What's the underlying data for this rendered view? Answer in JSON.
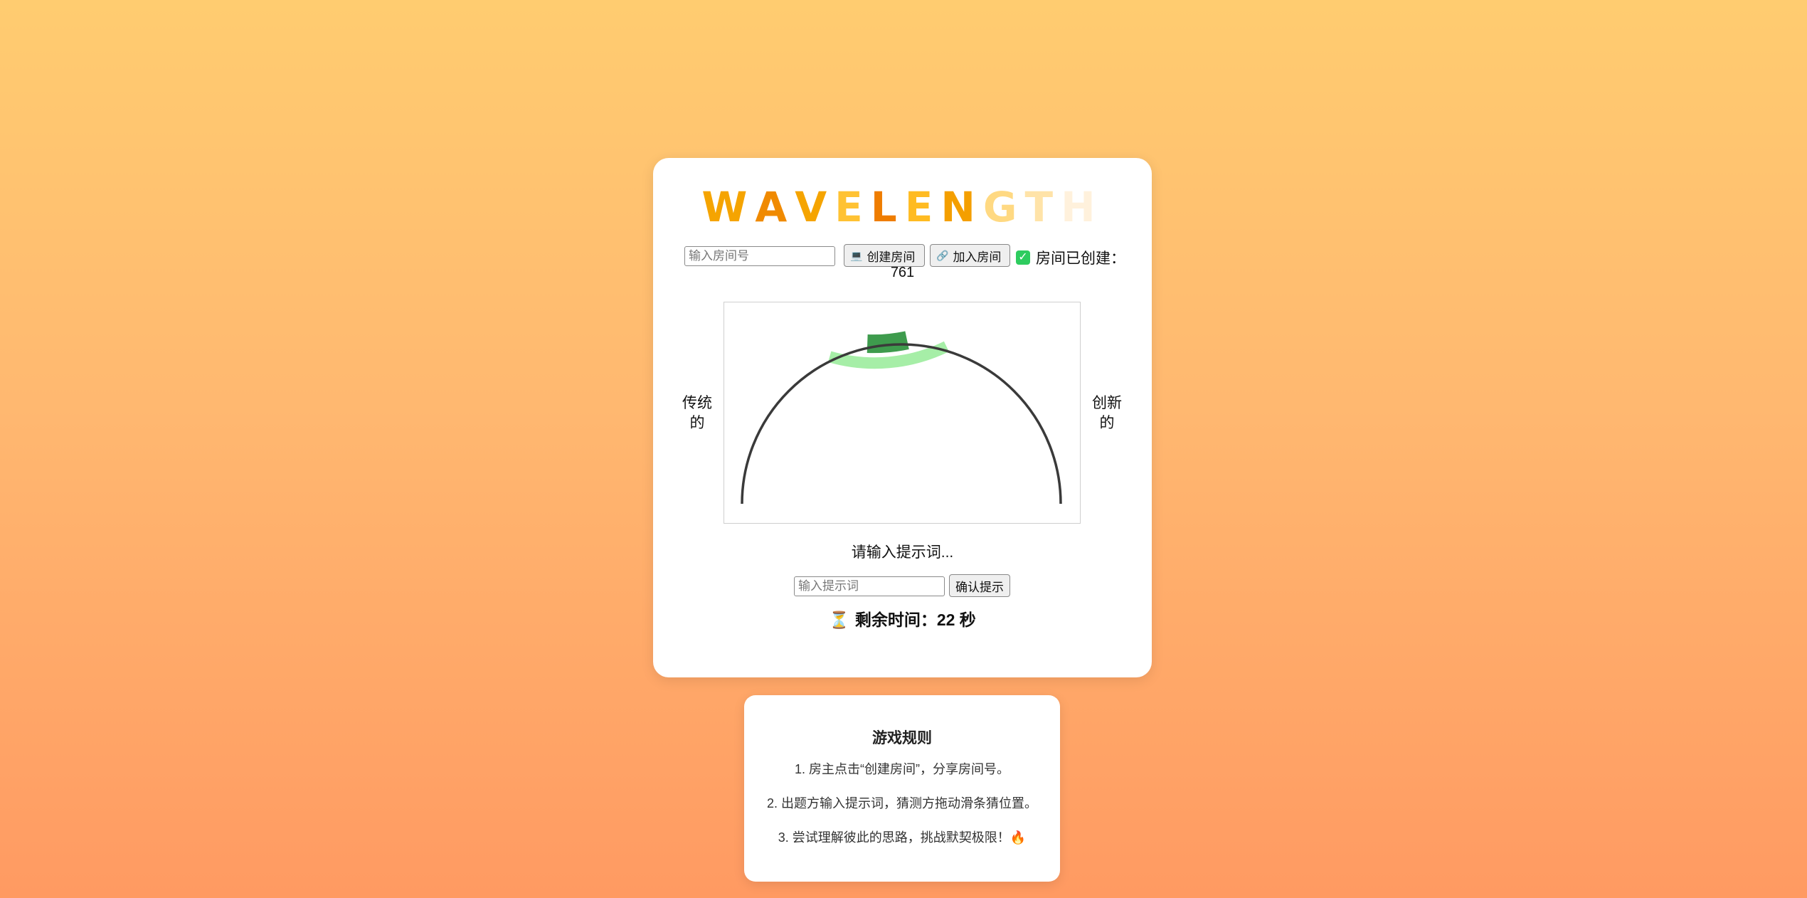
{
  "title": {
    "letters": [
      {
        "char": "W",
        "color": "#f5a400"
      },
      {
        "char": "A",
        "color": "#f08a00"
      },
      {
        "char": "V",
        "color": "#f5a400"
      },
      {
        "char": "E",
        "color": "#ffc233"
      },
      {
        "char": "L",
        "color": "#ef7d00"
      },
      {
        "char": "E",
        "color": "#ffbb22"
      },
      {
        "char": "N",
        "color": "#f49f00"
      },
      {
        "char": "G",
        "color": "#ffd982"
      },
      {
        "char": "T",
        "color": "#ffe3a8"
      },
      {
        "char": "H",
        "color": "#fff1dc"
      }
    ]
  },
  "room": {
    "input_placeholder": "输入房间号",
    "create_icon": "💻",
    "create_label": "创建房间",
    "join_icon": "🔗",
    "join_label": "加入房间",
    "status_icon": "✓",
    "status_text": "房间已创建：",
    "room_number": "761"
  },
  "dial": {
    "left_label": "传统的",
    "right_label": "创新的",
    "target_angle_deg": 85,
    "inner_band_half_width_deg": 7,
    "outer_band_half_width_deg": 21,
    "colors": {
      "arc": "#3a3a3a",
      "inner_band": "#3e9b4d",
      "outer_band": "#a6eea7"
    }
  },
  "prompt": {
    "status_text": "请输入提示词...",
    "input_placeholder": "输入提示词",
    "confirm_label": "确认提示"
  },
  "timer": {
    "icon": "⏳",
    "text": "剩余时间：22 秒"
  },
  "rules": {
    "title": "游戏规则",
    "items": [
      "1. 房主点击“创建房间”，分享房间号。",
      "2. 出题方输入提示词，猜测方拖动滑条猜位置。",
      "3. 尝试理解彼此的思路，挑战默契极限！🔥"
    ]
  }
}
